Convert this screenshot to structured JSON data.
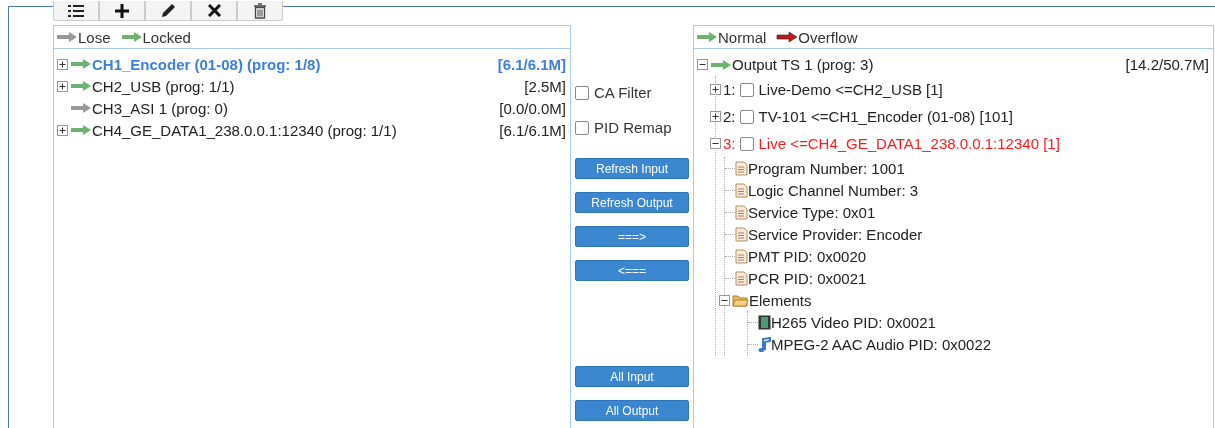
{
  "toolbar": [
    {
      "kind": "list"
    },
    {
      "kind": "add"
    },
    {
      "kind": "edit"
    },
    {
      "kind": "remove"
    },
    {
      "kind": "delete"
    }
  ],
  "input_panel": {
    "legend": [
      {
        "label": "Lose",
        "kind": "lose"
      },
      {
        "label": "Locked",
        "kind": "locked"
      }
    ],
    "channels": [
      {
        "name": "CH1_Encoder (01-08) (prog: 1/8)",
        "rate": "[6.1/6.1M]",
        "locked": true,
        "expandable": true,
        "selected": true
      },
      {
        "name": "CH2_USB (prog: 1/1)",
        "rate": "[2.5M]",
        "locked": true,
        "expandable": true,
        "selected": false
      },
      {
        "name": "CH3_ASI 1 (prog: 0)",
        "rate": "[0.0/0.0M]",
        "locked": false,
        "expandable": false,
        "selected": false
      },
      {
        "name": "CH4_GE_DATA1_238.0.0.1:12340 (prog: 1/1)",
        "rate": "[6.1/6.1M]",
        "locked": true,
        "expandable": true,
        "selected": false
      }
    ]
  },
  "options": [
    {
      "label": "CA Filter",
      "checked": false
    },
    {
      "label": "PID Remap",
      "checked": false
    }
  ],
  "buttons_top": [
    "Refresh Input",
    "Refresh Output",
    "===>",
    "<==="
  ],
  "buttons_bottom": [
    "All Input",
    "All Output"
  ],
  "output_panel": {
    "legend": [
      {
        "label": "Normal",
        "kind": "normal"
      },
      {
        "label": "Overflow",
        "kind": "overflow"
      }
    ],
    "output": {
      "label": "Output TS 1 (prog: 3)",
      "rate": "[14.2/50.7M]",
      "expanded": true,
      "overflow": false,
      "programs": [
        {
          "index": "1:",
          "label": "Live-Demo <=CH2_USB [1]",
          "checked": false,
          "expanded": false,
          "selected": false
        },
        {
          "index": "2:",
          "label": "TV-101 <=CH1_Encoder (01-08) [101]",
          "checked": false,
          "expanded": false,
          "selected": false
        },
        {
          "index": "3:",
          "label": "Live <=CH4_GE_DATA1_238.0.0.1:12340 [1]",
          "checked": false,
          "expanded": true,
          "selected": true,
          "children": [
            {
              "kind": "field",
              "label": "Program Number: 1001"
            },
            {
              "kind": "field",
              "label": "Logic Channel Number: 3"
            },
            {
              "kind": "field",
              "label": "Service Type: 0x01"
            },
            {
              "kind": "field",
              "label": "Service Provider: Encoder"
            },
            {
              "kind": "field",
              "label": "PMT PID: 0x0020"
            },
            {
              "kind": "field",
              "label": "PCR PID: 0x0021"
            },
            {
              "kind": "folder",
              "label": "Elements",
              "expanded": true,
              "children": [
                {
                  "kind": "video",
                  "label": "H265 Video PID: 0x0021"
                },
                {
                  "kind": "audio",
                  "label": "MPEG-2 AAC Audio PID: 0x0022"
                }
              ]
            }
          ]
        }
      ]
    }
  }
}
